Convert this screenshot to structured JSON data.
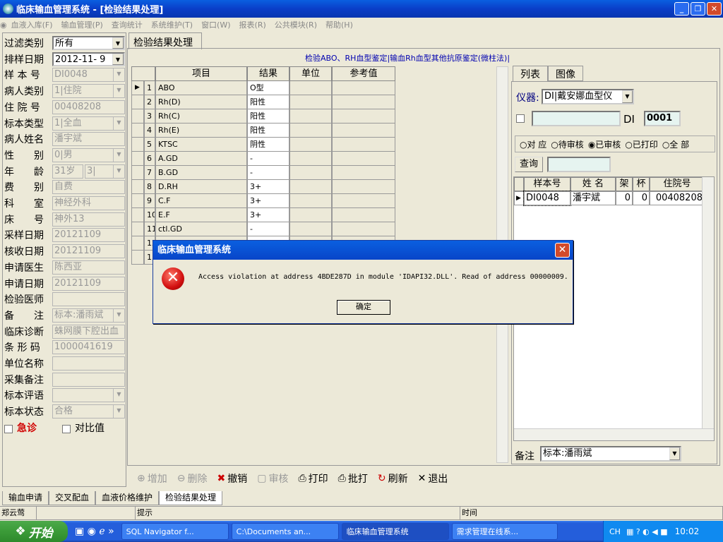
{
  "window": {
    "title": "临床输血管理系统 - [检验结果处理]"
  },
  "menu": [
    "血液入库(F)",
    "输血管理(P)",
    "查询统计",
    "系统维护(T)",
    "窗口(W)",
    "报表(R)",
    "公共模块(R)",
    "帮助(H)"
  ],
  "left_fields": [
    {
      "label": "过滤类别",
      "value": "所有",
      "dropdown": true,
      "white": true
    },
    {
      "label": "排样日期",
      "value": "2012-11- 9",
      "dropdown": true,
      "white": true
    },
    {
      "label": "样 本 号",
      "value": "DI0048",
      "dropdown": true
    },
    {
      "label": "病人类别",
      "value": "1|住院",
      "dropdown": true
    },
    {
      "label": "住 院 号",
      "value": "00408208"
    },
    {
      "label": "标本类型",
      "value": "1|全血",
      "dropdown": true
    },
    {
      "label": "病人姓名",
      "value": "潘宇斌"
    },
    {
      "label": "性　　别",
      "value": "0|男",
      "dropdown": true
    },
    {
      "label": "年　　龄",
      "value": "31岁",
      "extra": "3|"
    },
    {
      "label": "费　　别",
      "value": "自费"
    },
    {
      "label": "科　　室",
      "value": "神经外科"
    },
    {
      "label": "床　　号",
      "value": "神外13"
    },
    {
      "label": "采样日期",
      "value": "20121109"
    },
    {
      "label": "核收日期",
      "value": "20121109"
    },
    {
      "label": "申请医生",
      "value": "陈西亚"
    },
    {
      "label": "申请日期",
      "value": "20121109"
    },
    {
      "label": "检验医师",
      "value": ""
    },
    {
      "label": "备　　注",
      "value": "标本:潘雨斌",
      "dropdown": true
    },
    {
      "label": "临床诊断",
      "value": "蛛网膜下腔出血"
    },
    {
      "label": "条 形 码",
      "value": "1000041619"
    },
    {
      "label": "单位名称",
      "value": ""
    },
    {
      "label": "采集备注",
      "value": ""
    },
    {
      "label": "标本评语",
      "value": "",
      "dropdown": true
    },
    {
      "label": "标本状态",
      "value": "合格",
      "dropdown": true
    }
  ],
  "checks": {
    "urgent": "急诊",
    "compare": "对比值"
  },
  "main_tab": "检验结果处理",
  "link_line": "检验ABO、RH血型鉴定|输血Rh血型其他抗原鉴定(微柱法)|",
  "grid": {
    "headers": [
      "",
      "项目",
      "结果",
      "单位",
      "参考值"
    ],
    "rows": [
      [
        "1",
        "ABO",
        "O型"
      ],
      [
        "2",
        "Rh(D)",
        "阳性"
      ],
      [
        "3",
        "Rh(C)",
        "阳性"
      ],
      [
        "4",
        "Rh(E)",
        "阳性"
      ],
      [
        "5",
        "KTSC",
        "阴性"
      ],
      [
        "6",
        "A.GD",
        "-"
      ],
      [
        "7",
        "B.GD",
        "-"
      ],
      [
        "8",
        "D.RH",
        "3+"
      ],
      [
        "9",
        "C.F",
        "3+"
      ],
      [
        "10",
        "E.F",
        "3+"
      ],
      [
        "11",
        "ctl.GD",
        "-"
      ],
      [
        "12",
        "",
        ""
      ],
      [
        "13",
        "",
        ""
      ]
    ]
  },
  "right": {
    "tabs": [
      "列表",
      "图像"
    ],
    "instrument_label": "仪器:",
    "instrument_value": "DI|戴安娜血型仪",
    "prefix": "DI",
    "number": "0001",
    "radios": [
      "对 应",
      "待审核",
      "已审核",
      "已打印",
      "全 部"
    ],
    "query_btn": "查询",
    "headers": [
      "样本号",
      "姓 名",
      "架",
      "杯",
      "住院号"
    ],
    "row": [
      "DI0048",
      "潘宇斌",
      "0",
      "0",
      "00408208"
    ],
    "note_label": "备注",
    "note_value": "标本:潘雨斌"
  },
  "toolbar": [
    "增加",
    "删除",
    "撤销",
    "审核",
    "打印",
    "批打",
    "刷新",
    "退出"
  ],
  "bottom_tabs": [
    "输血申请",
    "交叉配血",
    "血液价格维护",
    "检验结果处理"
  ],
  "status": {
    "user": "郑云莺",
    "hint": "提示",
    "time": "时间"
  },
  "taskbar": {
    "start": "开始",
    "tasks": [
      "SQL Navigator f...",
      "C:\\Documents an...",
      "临床输血管理系统",
      "需求管理在线系..."
    ],
    "tray_text": "CH",
    "clock": "10:02"
  },
  "dialog": {
    "title": "临床输血管理系统",
    "message": "Access violation at address 4BDE287D in module 'IDAPI32.DLL'. Read of address 00000009.",
    "ok": "确定"
  }
}
